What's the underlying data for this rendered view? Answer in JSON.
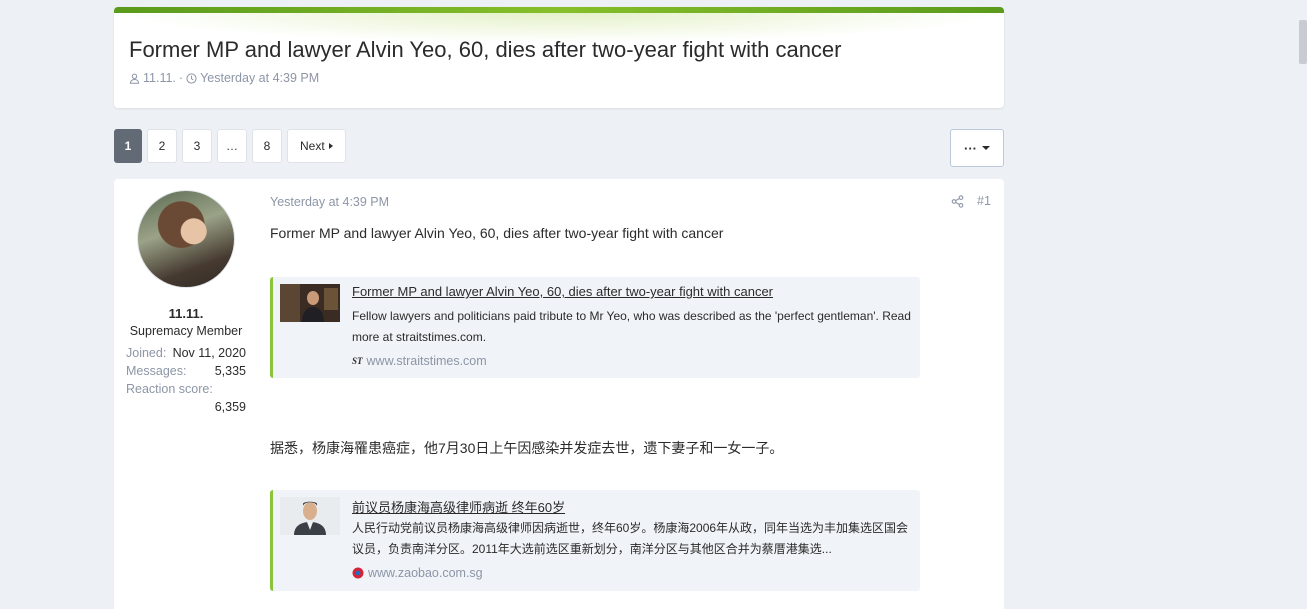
{
  "thread": {
    "title": "Former MP and lawyer Alvin Yeo, 60, dies after two-year fight with cancer",
    "author": "11.11.",
    "separator": "·",
    "date": "Yesterday at 4:39 PM"
  },
  "pagination": {
    "pages": [
      "1",
      "2",
      "3",
      "…",
      "8"
    ],
    "current": "1",
    "next_label": "Next",
    "more_label": "···"
  },
  "post": {
    "user": {
      "name": "11.11.",
      "title": "Supremacy Member",
      "stats": [
        {
          "label": "Joined:",
          "value": "Nov 11, 2020"
        },
        {
          "label": "Messages:",
          "value": "5,335"
        },
        {
          "label": "Reaction score:",
          "value": "6,359"
        }
      ]
    },
    "date": "Yesterday at 4:39 PM",
    "number": "#1",
    "text1": "Former MP and lawyer Alvin Yeo, 60, dies after two-year fight with cancer",
    "embed1": {
      "title": "Former MP and lawyer Alvin Yeo, 60, dies after two-year fight with cancer",
      "desc": "Fellow lawyers and politicians paid tribute to Mr Yeo, who was described as the 'perfect gentleman'. Read more at straitstimes.com.",
      "source": "www.straitstimes.com",
      "favicon": "ST"
    },
    "text2": "据悉，杨康海罹患癌症，他7月30日上午因感染并发症去世，遗下妻子和一女一子。",
    "embed2": {
      "title": "前议员杨康海高级律师病逝 终年60岁",
      "desc": "人民行动党前议员杨康海高级律师因病逝世，终年60岁。杨康海2006年从政，同年当选为丰加集选区国会议员，负责南洋分区。2011年大选前选区重新划分，南洋分区与其他区合并为蔡厝港集选...",
      "source": "www.zaobao.com.sg"
    }
  },
  "colors": {
    "accent": "#86bf2a",
    "muted": "#8c96a6",
    "page_current": "#616a75"
  }
}
